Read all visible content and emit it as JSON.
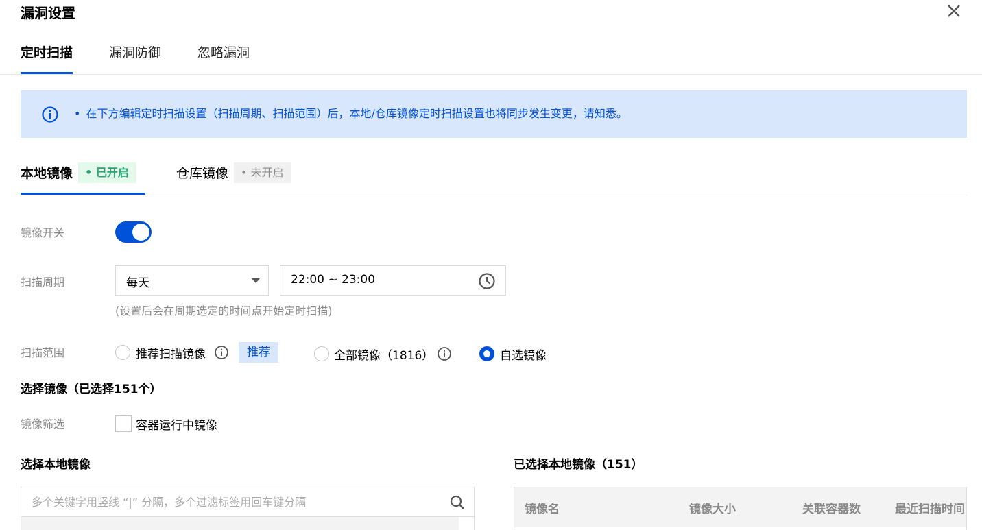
{
  "dialog": {
    "title": "漏洞设置"
  },
  "tabs": [
    {
      "label": "定时扫描",
      "active": true
    },
    {
      "label": "漏洞防御",
      "active": false
    },
    {
      "label": "忽略漏洞",
      "active": false
    }
  ],
  "notice": {
    "text": "在下方编辑定时扫描设置（扫描周期、扫描范围）后，本地/仓库镜像定时扫描设置也将同步发生变更，请知悉。"
  },
  "subtabs": [
    {
      "label": "本地镜像",
      "status": "已开启",
      "active": true
    },
    {
      "label": "仓库镜像",
      "status": "未开启",
      "active": false
    }
  ],
  "form": {
    "switch_label": "镜像开关",
    "switch_on": true,
    "period_label": "扫描周期",
    "period_value": "每天",
    "time_value": "22:00 ~ 23:00",
    "period_hint": "(设置后会在周期选定的时间点开始定时扫描)",
    "scope_label": "扫描范围",
    "scope_options": [
      {
        "label": "推荐扫描镜像",
        "checked": false
      },
      {
        "label": "全部镜像（1816）",
        "checked": false
      },
      {
        "label": "自选镜像",
        "checked": true
      }
    ],
    "recommend_tag": "推荐",
    "select_title": "选择镜像（已选择151个）",
    "filter_label": "镜像筛选",
    "filter_option": "容器运行中镜像"
  },
  "left_panel": {
    "title": "选择本地镜像",
    "search_placeholder": "多个关键字用竖线 “|” 分隔，多个过滤标签用回车键分隔"
  },
  "right_panel": {
    "title": "已选择本地镜像（151）",
    "columns": [
      "镜像名",
      "镜像大小",
      "关联容器数",
      "最近扫描时间"
    ]
  },
  "colors": {
    "primary": "#0052d9",
    "notice_bg": "#d9e7fc",
    "success": "#2ba471"
  }
}
